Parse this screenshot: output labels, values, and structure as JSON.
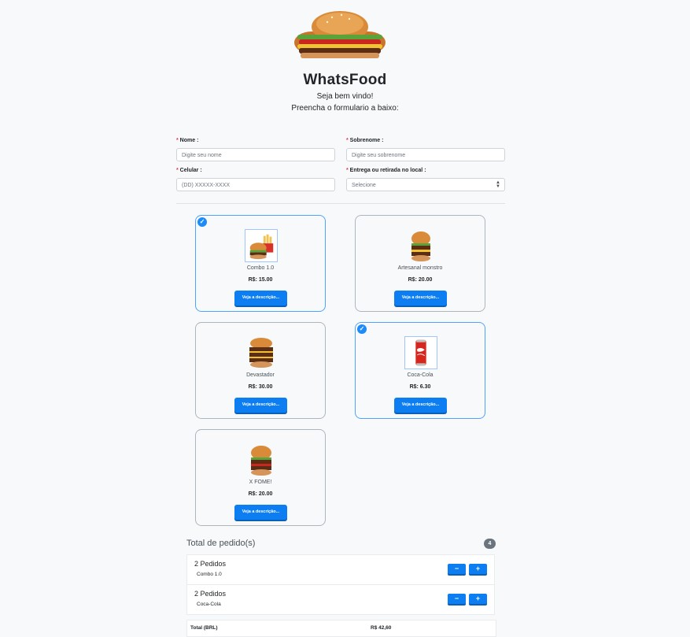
{
  "header": {
    "title": "WhatsFood",
    "welcome": "Seja bem vindo!",
    "instruction": "Preencha o formulario a baixo:"
  },
  "form": {
    "nome": {
      "label": "Nome :",
      "placeholder": "Digite seu nome"
    },
    "sobrenome": {
      "label": "Sobrenome :",
      "placeholder": "Digite seu sobrenome"
    },
    "celular": {
      "label": "Celular :",
      "placeholder": "(DD) XXXXX-XXXX"
    },
    "entrega": {
      "label": "Entrega ou retirada no local :",
      "selected": "Selecione"
    }
  },
  "products": [
    {
      "name": "Combo 1.0",
      "price": "R$: 15.00",
      "button": "Veja a descrição...",
      "selected": true,
      "icon": "combo-burger-fries-icon"
    },
    {
      "name": "Artesanal monstro",
      "price": "R$: 20.00",
      "button": "Veja a descrição...",
      "selected": false,
      "icon": "burger-icon"
    },
    {
      "name": "Devastador",
      "price": "R$: 30.00",
      "button": "Veja a descrição...",
      "selected": false,
      "icon": "triple-burger-icon"
    },
    {
      "name": "Coca-Cola",
      "price": "R$: 6.30",
      "button": "Veja a descrição...",
      "selected": true,
      "icon": "soda-can-icon"
    },
    {
      "name": "X FOME!",
      "price": "R$: 20.00",
      "button": "Veja a descrição...",
      "selected": false,
      "icon": "burger-icon"
    }
  ],
  "order": {
    "title": "Total de pedido(s)",
    "count": "4",
    "items": [
      {
        "qty": "2 Pedidos",
        "name": "Combo 1.0",
        "minus": "−",
        "plus": "+"
      },
      {
        "qty": "2 Pedidos",
        "name": "Coca-Cola",
        "minus": "−",
        "plus": "+"
      }
    ],
    "total_label": "Total (BRL)",
    "total_value": "R$ 42,60"
  },
  "colors": {
    "primary": "#0d7ef2",
    "selected_border": "#4da3ff",
    "badge": "#6c757d",
    "required": "#dc3545"
  }
}
